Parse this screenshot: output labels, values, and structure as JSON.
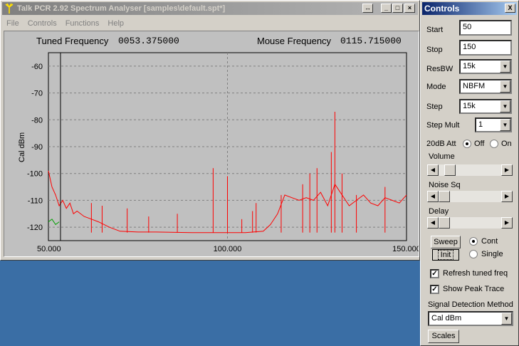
{
  "main_window": {
    "title": "Talk PCR 2.92 Spectrum Analyser [samples\\default.spt*]",
    "menu": [
      "File",
      "Controls",
      "Functions",
      "Help"
    ],
    "tuned_label": "Tuned Frequency",
    "tuned_value": "0053.375000",
    "mouse_label": "Mouse Frequency",
    "mouse_value": "0115.715000"
  },
  "chart_data": {
    "type": "line",
    "ylabel": "Cal dBm",
    "xlim": [
      50,
      150
    ],
    "ylim": [
      -125,
      -55
    ],
    "x_ticks": [
      "50.000",
      "100.000",
      "150.000"
    ],
    "y_ticks": [
      "-60",
      "-70",
      "-80",
      "-90",
      "-100",
      "-110",
      "-120"
    ],
    "tuned_marker_x": 53.375,
    "trace_color": "#ff0000",
    "peak_trace_color": "#00a000",
    "grid": true,
    "series": [
      {
        "values": [
          [
            50,
            -99
          ],
          [
            51,
            -105
          ],
          [
            52,
            -108
          ],
          [
            53,
            -112
          ],
          [
            54,
            -110
          ],
          [
            55,
            -113
          ],
          [
            56,
            -111
          ],
          [
            57,
            -115
          ],
          [
            58,
            -114
          ],
          [
            60,
            -116
          ],
          [
            62,
            -117
          ],
          [
            64,
            -118
          ],
          [
            67,
            -120
          ],
          [
            70,
            -121.5
          ],
          [
            75,
            -121.8
          ],
          [
            80,
            -121.8
          ],
          [
            90,
            -122
          ],
          [
            100,
            -122
          ],
          [
            105,
            -122
          ],
          [
            110,
            -121.5
          ],
          [
            112,
            -119
          ],
          [
            114,
            -115
          ],
          [
            116,
            -108
          ],
          [
            118,
            -109
          ],
          [
            120,
            -110
          ],
          [
            122,
            -109
          ],
          [
            124,
            -110
          ],
          [
            126,
            -107
          ],
          [
            128,
            -112
          ],
          [
            130,
            -104
          ],
          [
            132,
            -108
          ],
          [
            134,
            -112
          ],
          [
            136,
            -110
          ],
          [
            138,
            -108
          ],
          [
            140,
            -111
          ],
          [
            142,
            -112
          ],
          [
            144,
            -109
          ],
          [
            146,
            -110
          ],
          [
            148,
            -111
          ],
          [
            150,
            -108
          ]
        ]
      }
    ],
    "spikes": [
      [
        62,
        -111
      ],
      [
        65,
        -112
      ],
      [
        72,
        -113
      ],
      [
        78,
        -116
      ],
      [
        86,
        -115
      ],
      [
        96,
        -98
      ],
      [
        100,
        -101
      ],
      [
        104,
        -117
      ],
      [
        107,
        -114
      ],
      [
        108,
        -111
      ],
      [
        115,
        -108
      ],
      [
        121,
        -104
      ],
      [
        123,
        -100
      ],
      [
        125,
        -98
      ],
      [
        129,
        -92
      ],
      [
        130,
        -77
      ],
      [
        132,
        -100
      ],
      [
        136,
        -108
      ],
      [
        144,
        -105
      ]
    ]
  },
  "controls_window": {
    "title": "Controls",
    "close_glyph": "X",
    "start_label": "Start",
    "start_value": "50",
    "stop_label": "Stop",
    "stop_value": "150",
    "resbw_label": "ResBW",
    "resbw_value": "15k",
    "mode_label": "Mode",
    "mode_value": "NBFM",
    "step_label": "Step",
    "step_value": "15k",
    "stepmult_label": "Step Mult",
    "stepmult_value": "1",
    "att_label": "20dB Att",
    "att_off": "Off",
    "att_on": "On",
    "volume_label": "Volume",
    "volume_level": 0.1,
    "noisesq_label": "Noise Sq",
    "noisesq_level": 0.0,
    "delay_label": "Delay",
    "delay_level": 0.0,
    "sweep_label": "Sweep",
    "init_label": "Init",
    "cont_label": "Cont",
    "single_label": "Single",
    "refresh_label": "Refresh tuned freq",
    "peak_label": "Show Peak Trace",
    "detection_label": "Signal Detection Method",
    "detection_value": "Cal dBm",
    "scales_label": "Scales"
  }
}
